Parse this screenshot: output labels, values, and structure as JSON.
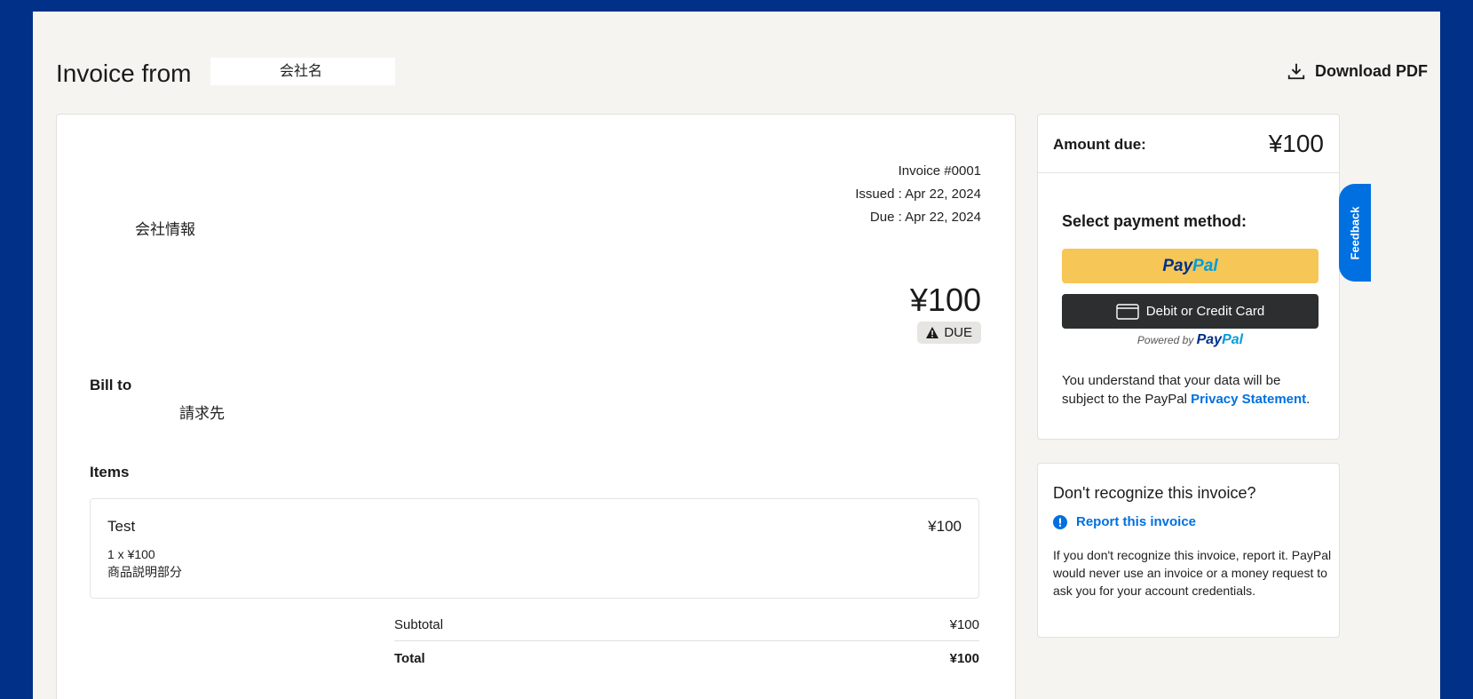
{
  "header": {
    "title_prefix": "Invoice from",
    "company_name": "会社名",
    "download_label": "Download PDF"
  },
  "invoice": {
    "number": "Invoice #0001",
    "issued": "Issued : Apr 22, 2024",
    "due": "Due : Apr 22, 2024",
    "company_info": "会社情報",
    "amount": "¥100",
    "status": "DUE",
    "bill_to_label": "Bill to",
    "bill_to_value": "請求先",
    "items_label": "Items",
    "items": [
      {
        "name": "Test",
        "price": "¥100",
        "qty": "1 x ¥100",
        "description": "商品説明部分"
      }
    ],
    "subtotal_label": "Subtotal",
    "subtotal_value": "¥100",
    "total_label": "Total",
    "total_value": "¥100"
  },
  "payment": {
    "amount_due_label": "Amount due:",
    "amount_due_value": "¥100",
    "select_method": "Select payment method:",
    "paypal_pay": "Pay",
    "paypal_pal": "Pal",
    "card_button": "Debit or Credit Card",
    "powered_by": "Powered by",
    "consent_text": "You understand that your data will be subject to the PayPal ",
    "consent_link": "Privacy Statement",
    "consent_end": "."
  },
  "report": {
    "title": "Don't recognize this invoice?",
    "link": "Report this invoice",
    "body": "If you don't recognize this invoice, report it. PayPal would never use an invoice or a money request to ask you for your account credentials."
  },
  "feedback": {
    "label": "Feedback"
  },
  "colors": {
    "background": "#003087",
    "paypal_yellow": "#f6c757",
    "link_blue": "#0070e0",
    "card_dark": "#2c2e2f"
  }
}
